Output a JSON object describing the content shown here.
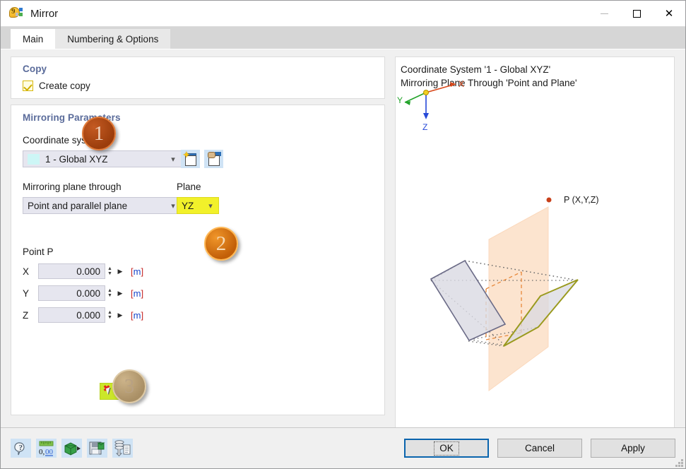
{
  "window": {
    "title": "Mirror",
    "icon": "mirror-app-icon",
    "controls": {
      "minimize": "—",
      "maximize": "□",
      "close": "✕"
    }
  },
  "tabs": [
    {
      "label": "Main",
      "active": true
    },
    {
      "label": "Numbering & Options",
      "active": false
    }
  ],
  "copy": {
    "group_title": "Copy",
    "create_copy_label": "Create copy",
    "create_copy_checked": true
  },
  "mirroring": {
    "group_title": "Mirroring Parameters",
    "coordinate_system_label": "Coordinate system",
    "coordinate_system_value": "1 - Global XYZ",
    "coordinate_system_swatch": "#cdf6f6",
    "new_cs_button": "new-coordinate-system-icon",
    "edit_cs_button": "edit-coordinate-system-icon",
    "plane_through_label": "Mirroring plane through",
    "plane_through_value": "Point and parallel plane",
    "plane_label": "Plane",
    "plane_value": "YZ",
    "plane_highlight_color": "#f2f12a",
    "point_group_label": "Point P",
    "coords": [
      {
        "axis": "X",
        "value": "0.000",
        "unit": "[m]"
      },
      {
        "axis": "Y",
        "value": "0.000",
        "unit": "[m]"
      },
      {
        "axis": "Z",
        "value": "0.000",
        "unit": "[m]"
      }
    ],
    "pick_button": "pick-point-in-graphic-icon"
  },
  "badges": [
    {
      "number": "1",
      "color": "#9b3d0c"
    },
    {
      "number": "2",
      "color": "#c25f08"
    },
    {
      "number": "3",
      "color": "#a98f65"
    }
  ],
  "preview": {
    "line1": "Coordinate System '1 - Global XYZ'",
    "line2": "Mirroring Plane Through 'Point and Plane'",
    "axes": {
      "x": "X",
      "y": "Y",
      "z": "Z",
      "x_color": "#d8481b",
      "y_color": "#22a32a",
      "z_color": "#2649d8",
      "origin_color": "#f2d024"
    },
    "point_label": "P (X,Y,Z)",
    "point_color": "#c8401a",
    "plane_fill": "#fce4cf",
    "original_outline": "#6a6a86",
    "mirrored_outline": "#9a9a1e",
    "corner_button": "toggle-view-icon"
  },
  "footer": {
    "tools": [
      {
        "name": "help-icon",
        "label": "?"
      },
      {
        "name": "decimal-places-icon",
        "label": "0,00"
      },
      {
        "name": "units-icon",
        "label": ""
      },
      {
        "name": "save-defaults-icon",
        "label": ""
      },
      {
        "name": "import-from-database-icon",
        "label": ""
      }
    ],
    "buttons": [
      {
        "name": "ok-button",
        "label": "OK",
        "primary": true
      },
      {
        "name": "cancel-button",
        "label": "Cancel",
        "primary": false
      },
      {
        "name": "apply-button",
        "label": "Apply",
        "primary": false
      }
    ]
  }
}
